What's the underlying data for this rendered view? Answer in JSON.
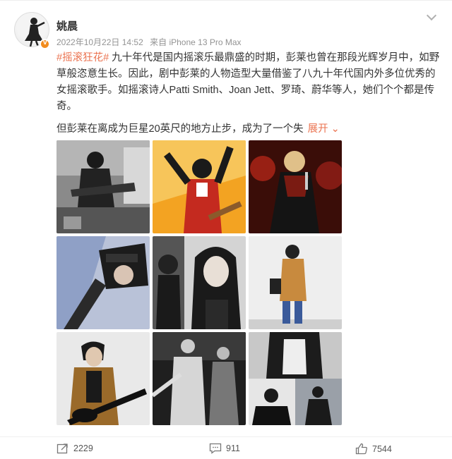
{
  "user": {
    "name": "姚晨"
  },
  "meta": {
    "time": "2022年10月22日 14:52",
    "source": "来自 iPhone 13 Pro Max"
  },
  "post": {
    "hashtag": "#摇滚狂花#",
    "text": "九十年代是国内摇滚乐最鼎盛的时期，彭莱也曾在那段光辉岁月中，如野草般恣意生长。因此，剧中彭莱的人物造型大量借鉴了八九十年代国内外多位优秀的女摇滚歌手。如摇滚诗人Patti Smith、Joan Jett、罗琦、蔚华等人，她们个个都是传奇。",
    "line2": "但彭莱在离成为巨星20英尺的地方止步，成为了一个失",
    "expand": "展开"
  },
  "photos": [
    {
      "name": "photo-1"
    },
    {
      "name": "photo-2"
    },
    {
      "name": "photo-3"
    },
    {
      "name": "photo-4"
    },
    {
      "name": "photo-5"
    },
    {
      "name": "photo-6"
    },
    {
      "name": "photo-7"
    },
    {
      "name": "photo-8"
    },
    {
      "name": "photo-9"
    }
  ],
  "actions": {
    "repost": "2229",
    "comment": "911",
    "like": "7544"
  },
  "colors": {
    "accent": "#eb7350",
    "verified": "#f28c1e",
    "meta": "#939393"
  }
}
